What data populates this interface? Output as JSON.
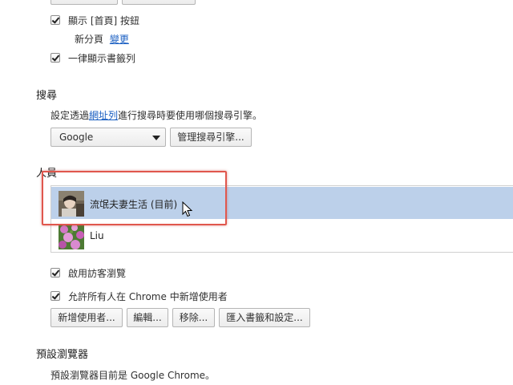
{
  "appearance": {
    "show_home_label": "顯示 [首頁] 按鈕",
    "new_tab_label": "新分頁",
    "change_link": "變更",
    "bookmarks_bar_label": "一律顯示書籤列"
  },
  "search": {
    "heading": "搜尋",
    "desc_prefix": "設定透過",
    "desc_link": "網址列",
    "desc_suffix": "進行搜尋時要使用哪個搜尋引擎。",
    "engine_value": "Google",
    "manage_button": "管理搜尋引擎..."
  },
  "people": {
    "heading": "人員",
    "users": [
      {
        "name": "流氓夫妻生活 (目前)",
        "selected": true
      },
      {
        "name": "Liu",
        "selected": false
      }
    ],
    "guest_label": "啟用訪客瀏覽",
    "allow_add_label": "允許所有人在 Chrome 中新增使用者",
    "buttons": {
      "add": "新增使用者...",
      "edit": "編輯...",
      "remove": "移除...",
      "import": "匯入書籤和設定..."
    }
  },
  "default_browser": {
    "heading": "預設瀏覽器",
    "desc": "預設瀏覽器目前是 Google Chrome。"
  },
  "colors": {
    "selected_row": "#bcd0ea",
    "link": "#1a5fc2",
    "highlight": "#e0574d"
  },
  "icons": [
    "checkbox-icon",
    "dropdown-arrow-icon",
    "avatar-image",
    "mouse-cursor-icon"
  ]
}
